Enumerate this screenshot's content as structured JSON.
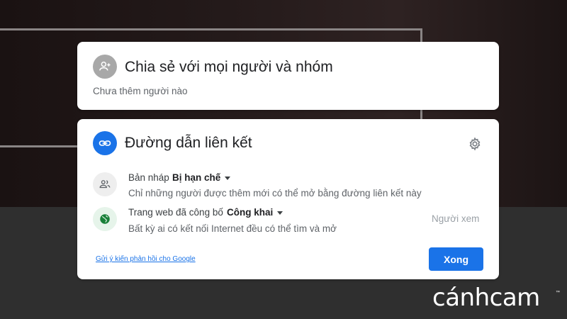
{
  "share_card": {
    "title": "Chia sẻ với mọi người và nhóm",
    "subtitle": "Chưa thêm người nào",
    "icon": "person-add-icon"
  },
  "link_card": {
    "title": "Đường dẫn liên kết",
    "icon": "link-icon",
    "settings_icon": "gear-icon",
    "rows": [
      {
        "label": "Bản nháp",
        "value": "Bị hạn chế",
        "description": "Chỉ những người được thêm mới có thể mở bằng đường liên kết này",
        "icon": "people-icon"
      },
      {
        "label": "Trang web đã công bố",
        "value": "Công khai",
        "description": "Bất kỳ ai có kết nối Internet đều có thể tìm và mở",
        "icon": "globe-icon"
      }
    ],
    "role_label": "Người xem",
    "feedback_link": "Gửi ý kiến phản hồi cho Google",
    "done_button": "Xong"
  },
  "watermark": {
    "text": "cánhcam",
    "tm": "™"
  },
  "colors": {
    "accent": "#1a73e8",
    "globe_green": "#188038"
  }
}
